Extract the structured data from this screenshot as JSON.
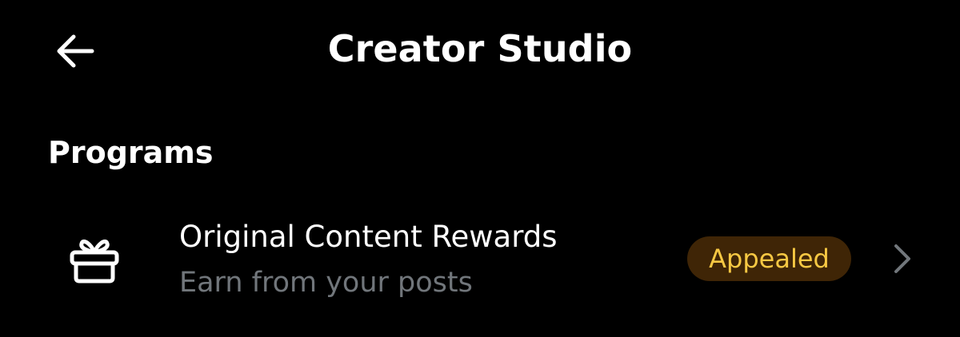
{
  "header": {
    "title": "Creator Studio",
    "back_icon": "arrow-left-icon"
  },
  "programs": {
    "heading": "Programs",
    "items": [
      {
        "icon": "gift-icon",
        "title": "Original Content Rewards",
        "subtitle": "Earn from your posts",
        "status": "Appealed",
        "chevron_icon": "chevron-right-icon"
      }
    ]
  },
  "colors": {
    "background": "#000000",
    "text_primary": "#ffffff",
    "text_secondary": "#71767b",
    "badge_background": "#3f2506",
    "badge_text": "#f7c843",
    "chevron": "#71767b"
  }
}
